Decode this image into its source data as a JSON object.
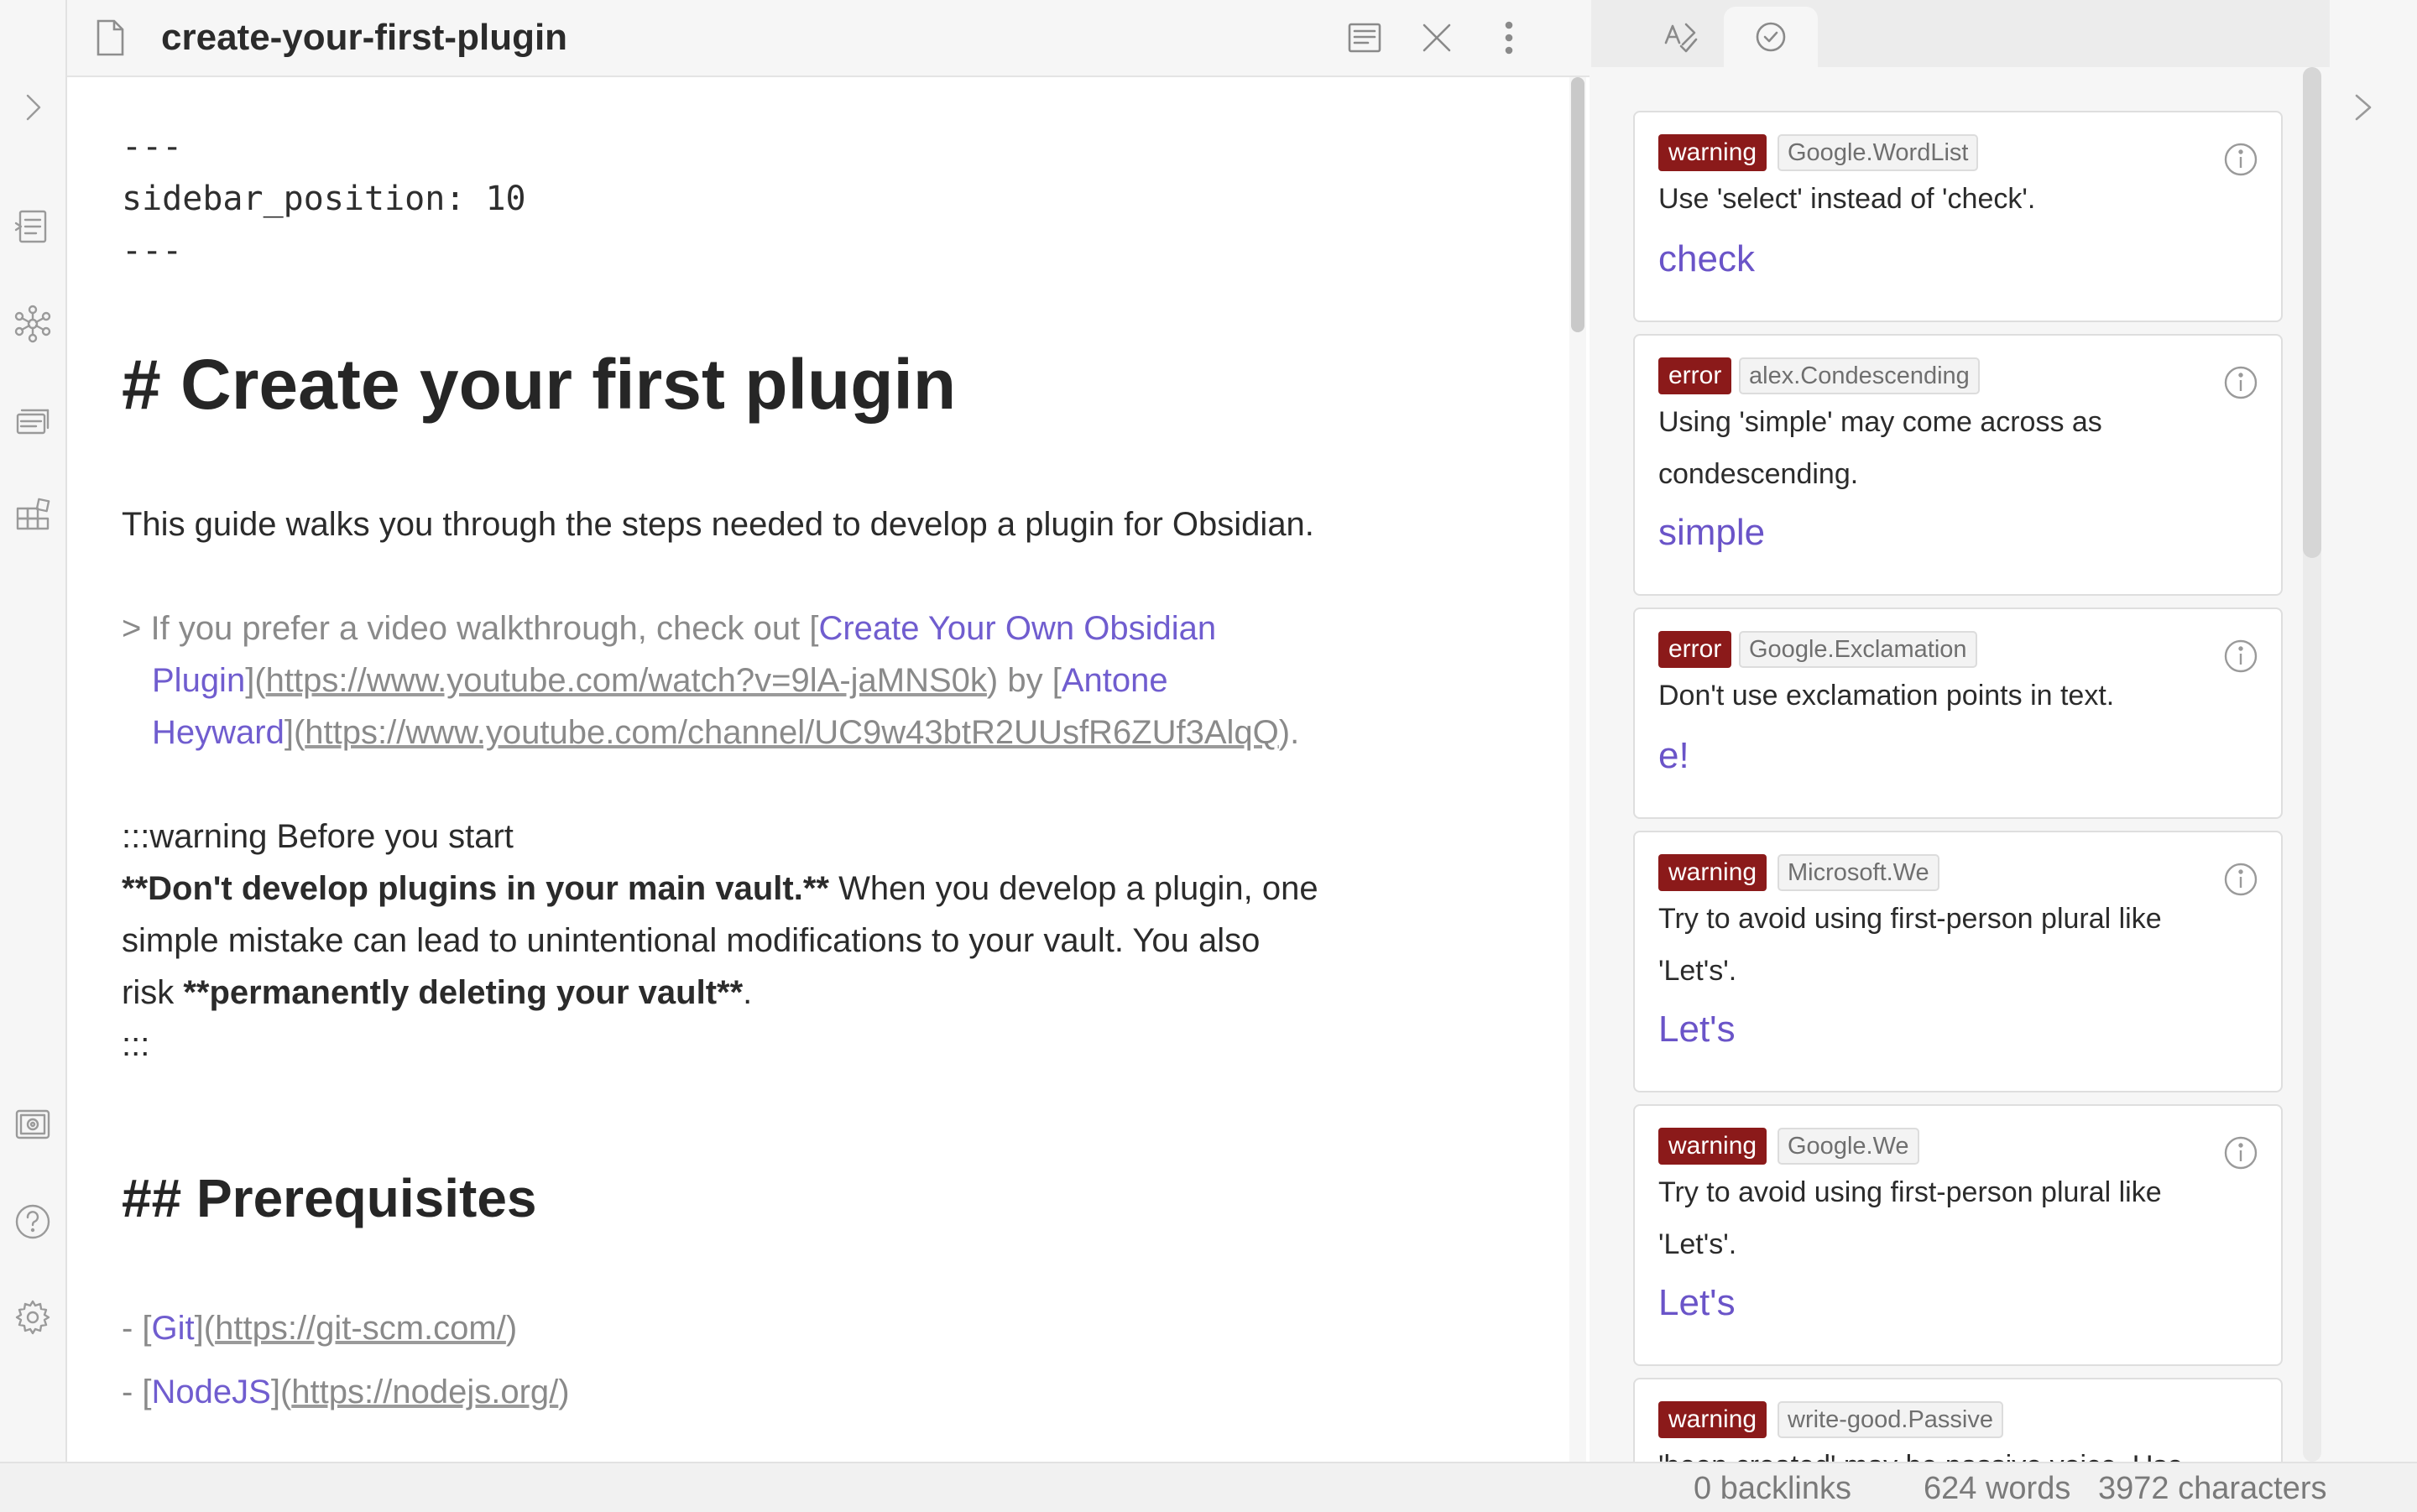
{
  "tab": {
    "title": "create-your-first-plugin"
  },
  "editor": {
    "frontmatter": [
      "---",
      "sidebar_position: 10",
      "---"
    ],
    "heading1": "# Create your first plugin",
    "intro": "This guide walks you through the steps needed to develop a plugin for Obsidian.",
    "quote": {
      "prefix": "> If you prefer a video walkthrough, check out [",
      "link1_text": "Create Your Own Obsidian",
      "link1_text_cont": "Plugin",
      "link1_bracket": "](",
      "link1_url": "https://www.youtube.com/watch?v=9lA-jaMNS0k",
      "link1_close": ")",
      "by": " by [",
      "link2_text": "Antone",
      "link2_text_cont": "Heyward",
      "link2_bracket": "](",
      "link2_url": "https://www.youtube.com/channel/UC9w43btR2UUsfR6ZUf3AlqQ",
      "link2_close": ").",
      "close": "."
    },
    "admonition": {
      "open": ":::warning Before you start",
      "bold1": "**Don't develop plugins in your main vault.**",
      "text1": " When you develop a plugin, one",
      "text2": "simple mistake can lead to unintentional modifications to your vault. You also",
      "text3_pre": "risk ",
      "bold2": "**permanently deleting your vault**",
      "text3_post": ".",
      "close": ":::"
    },
    "heading2": "## Prerequisites",
    "list": [
      {
        "prefix": "- [",
        "text": "Git",
        "bracket": "](",
        "url": "https://git-scm.com/",
        "close": ")"
      },
      {
        "prefix": "- [",
        "text": "NodeJS",
        "bracket": "](",
        "url": "https://nodejs.org/",
        "close": ")"
      }
    ]
  },
  "sidebar": {
    "cards": [
      {
        "severity": "warning",
        "rule": "Google.WordList",
        "message": "Use 'select' instead of 'check'.",
        "match": "check"
      },
      {
        "severity": "error",
        "rule": "alex.Condescending",
        "message": "Using 'simple' may come across as condescending.",
        "match": "simple"
      },
      {
        "severity": "error",
        "rule": "Google.Exclamation",
        "message": "Don't use exclamation points in text.",
        "match": "e!"
      },
      {
        "severity": "warning",
        "rule": "Microsoft.We",
        "message": "Try to avoid using first-person plural like 'Let's'.",
        "match": "Let's"
      },
      {
        "severity": "warning",
        "rule": "Google.We",
        "message": "Try to avoid using first-person plural like 'Let's'.",
        "match": "Let's"
      },
      {
        "severity": "warning",
        "rule": "write-good.Passive",
        "message": "'been created' may be passive voice. Use",
        "match": ""
      }
    ]
  },
  "status": {
    "backlinks": "0 backlinks",
    "words": "624 words",
    "characters": "3972 characters"
  },
  "colors": {
    "badge_bg": "#8b1a1a",
    "link": "#705dcf",
    "match": "#6a54c8"
  },
  "icons": {
    "ribbon": [
      "chevron-right-icon",
      "file-explorer-icon",
      "graph-icon",
      "cards-icon",
      "blocks-icon",
      "capture-icon",
      "help-icon",
      "settings-icon"
    ],
    "tab_actions": [
      "reading-view-icon",
      "close-icon",
      "more-options-icon"
    ],
    "sidebar_tabs": [
      "spellcheck-icon",
      "check-circle-icon"
    ]
  }
}
